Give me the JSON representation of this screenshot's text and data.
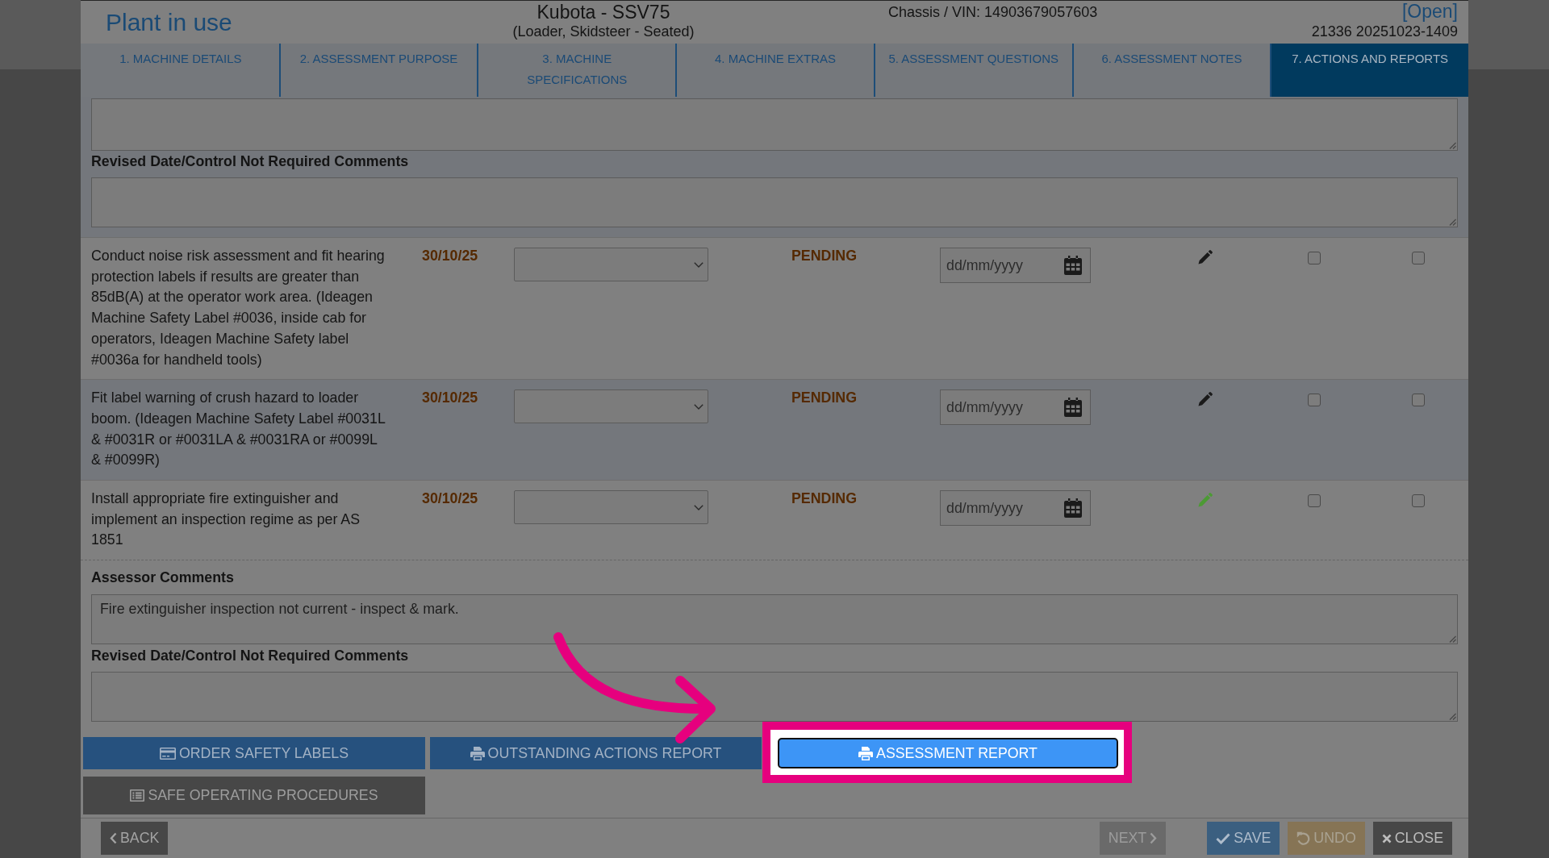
{
  "header": {
    "title": "Plant in use",
    "machine": "Kubota - SSV75",
    "machine_type": "(Loader, Skidsteer - Seated)",
    "chassis_vin": "Chassis / VIN: 14903679057603",
    "status": "[Open]",
    "reference": "21336 20251023-1409"
  },
  "tabs": [
    {
      "label": "1. MACHINE DETAILS",
      "selected": false
    },
    {
      "label": "2. ASSESSMENT PURPOSE",
      "selected": false
    },
    {
      "label": "3. MACHINE SPECIFICATIONS",
      "selected": false
    },
    {
      "label": "4. MACHINE EXTRAS",
      "selected": false
    },
    {
      "label": "5. ASSESSMENT QUESTIONS",
      "selected": false
    },
    {
      "label": "6. ASSESSMENT NOTES",
      "selected": false
    },
    {
      "label": "7. ACTIONS AND REPORTS",
      "selected": true
    }
  ],
  "upper_comments": {
    "label": "Revised Date/Control Not Required Comments"
  },
  "actions": [
    {
      "description": "Conduct noise risk assessment and fit hearing protection labels if results are greater than 85dB(A) at the operator work area. (Ideagen Machine Safety Label #0036, inside cab for operators, Ideagen Machine Safety label #0036a for handheld tools)",
      "due": "30/10/25",
      "status": "PENDING",
      "revised_date": {
        "placeholder": "dd/mm/yyyy"
      },
      "notes_added": false,
      "checkbox_1_checked": false,
      "checkbox_2_checked": false
    },
    {
      "description": "Fit label warning of crush hazard to loader boom. (Ideagen Machine Safety Label #0031L & #0031R or #0031LA & #0031RA or #0099L & #0099R)",
      "due": "30/10/25",
      "status": "PENDING",
      "revised_date": {
        "placeholder": "dd/mm/yyyy"
      },
      "notes_added": false,
      "checkbox_1_checked": false,
      "checkbox_2_checked": false
    },
    {
      "description": "Install appropriate fire extinguisher and implement an inspection regime as per AS 1851",
      "due": "30/10/25",
      "status": "PENDING",
      "revised_date": {
        "placeholder": "dd/mm/yyyy"
      },
      "notes_added": true,
      "checkbox_1_checked": false,
      "checkbox_2_checked": false
    }
  ],
  "assessor_comments": {
    "label": "Assessor Comments",
    "value": "Fire extinguisher inspection not current - inspect & mark."
  },
  "revised_comments": {
    "label": "Revised Date/Control Not Required Comments"
  },
  "report_buttons": [
    {
      "kind": "order_labels",
      "label": "ORDER SAFETY LABELS",
      "highlighted": false
    },
    {
      "kind": "outstanding_report",
      "label": "OUTSTANDING ACTIONS REPORT",
      "highlighted": false
    },
    {
      "kind": "assessment_report",
      "label": "ASSESSMENT REPORT",
      "highlighted": true
    },
    {
      "kind": "procedures",
      "label": "SAFE OPERATING PROCEDURES",
      "highlighted": false
    }
  ],
  "footer_buttons": [
    {
      "kind": "back",
      "label": "BACK",
      "disabled": false
    },
    {
      "kind": "next",
      "label": "NEXT",
      "disabled": true
    },
    {
      "kind": "save",
      "label": "SAVE",
      "disabled": false
    },
    {
      "kind": "undo",
      "label": "UNDO",
      "disabled": true
    },
    {
      "kind": "close",
      "label": "CLOSE",
      "disabled": false
    }
  ]
}
